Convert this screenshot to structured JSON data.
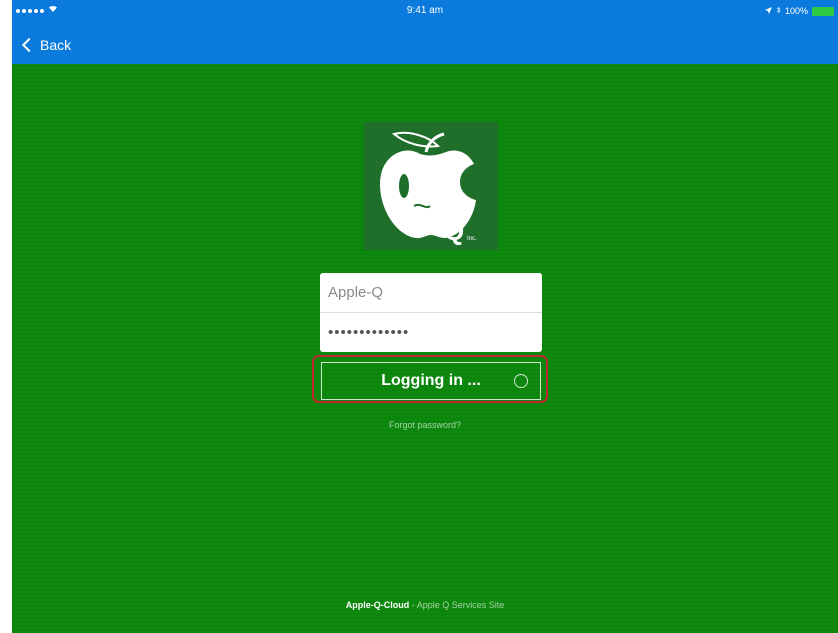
{
  "status_bar": {
    "time": "9:41 am",
    "battery": "100%"
  },
  "nav": {
    "back_label": "Back"
  },
  "logo": {
    "text": "Q",
    "suffix": "Inc."
  },
  "login": {
    "username_value": "Apple-Q",
    "password_value": "•••••••••••••",
    "button_label": "Logging in ...",
    "forgot_label": "Forgot password?"
  },
  "footer": {
    "brand": "Apple-Q-Cloud",
    "separator": " - ",
    "tagline": "Apple Q Services Site"
  },
  "colors": {
    "nav_blue": "#0a7bdc",
    "background_green": "#0d8a0d",
    "logo_green": "#1f6e2a",
    "highlight_red": "#c0282d"
  }
}
